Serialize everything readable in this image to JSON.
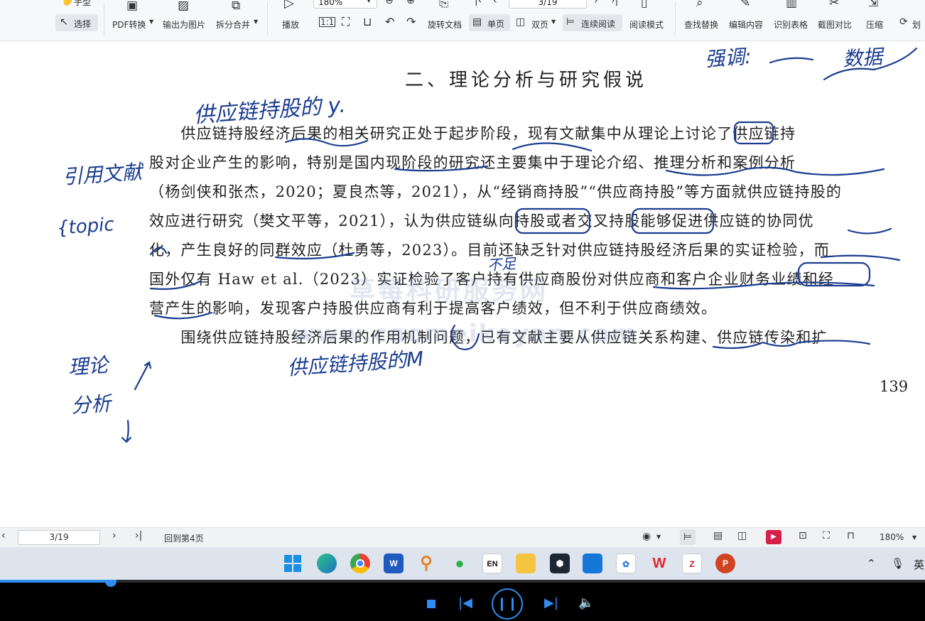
{
  "toolbar": {
    "hand_label": "手型",
    "select_label": "选择",
    "pdf_convert_label": "PDF转换",
    "export_image_label": "输出为图片",
    "split_merge_label": "拆分合并",
    "play_label": "播放",
    "zoom_value": "180%",
    "page_input_value": "3/19",
    "rotate_label": "旋转文档",
    "single_page_label": "单页",
    "double_page_label": "双页",
    "continuous_label": "连续阅读",
    "read_mode_label": "阅读模式",
    "find_replace_label": "查找替换",
    "edit_content_label": "编辑内容",
    "recognize_table_label": "识别表格",
    "screenshot_compare_label": "截图对比",
    "compress_label": "压缩",
    "more_label": "划"
  },
  "document": {
    "heading": "二、理论分析与研究假说",
    "lines": [
      "　　供应链持股经济后果的相关研究正处于起步阶段，现有文献集中从理论上讨论了供应链持",
      "股对企业产生的影响，特别是国内现阶段的研究还主要集中于理论介绍、推理分析和案例分析",
      "（杨剑侠和张杰，2020；夏良杰等，2021），从“经销商持股”“供应商持股”等方面就供应链持股的",
      "效应进行研究（樊文平等，2021），认为供应链纵向持股或者交叉持股能够促进供应链的协同优",
      "化，产生良好的同群效应（杜勇等，2023）。目前还缺乏针对供应链持股经济后果的实证检验，而",
      "国外仅有 Haw et al.（2023）实证检验了客户持有供应商股份对供应商和客户企业财务业绩和经",
      "营产生的影响，发现客户持股供应商有利于提高客户绩效，但不利于供应商绩效。",
      "　　围绕供应链持股经济后果的作用机制问题，已有文献主要从供应链关系构建、供应链传染和扩"
    ],
    "page_number": "139",
    "watermark_cn": "草莓科研服务网",
    "watermark_en": "www.caomeikeyan.com"
  },
  "annotations": {
    "top_left": "供应链持股的 y.",
    "top_right_1": "强调:",
    "top_right_2": "数据",
    "left_1": "引用文献",
    "left_2": "{topic",
    "left_3": "理论",
    "left_4": "分析",
    "bottom_mid": "供应链持股的M",
    "mid_note": "不足"
  },
  "statusbar": {
    "page_value": "3/19",
    "goto_label": "回到第4页",
    "zoom_label": "180%"
  },
  "taskbar": {
    "apps": [
      "windows-start",
      "edge",
      "chrome",
      "word",
      "search-tool",
      "wechat",
      "en-dict",
      "file-explorer",
      "app-cube",
      "app-blue",
      "app-network",
      "wps",
      "file-z",
      "powerpoint"
    ],
    "en_app_label": "EN",
    "word_app_label": "W",
    "wps_app_label": "W",
    "z_app_label": "Z",
    "ppt_app_label": "P",
    "ime_label": "英"
  },
  "player": {
    "progress": 0.12,
    "accent": "#2f8df2"
  }
}
